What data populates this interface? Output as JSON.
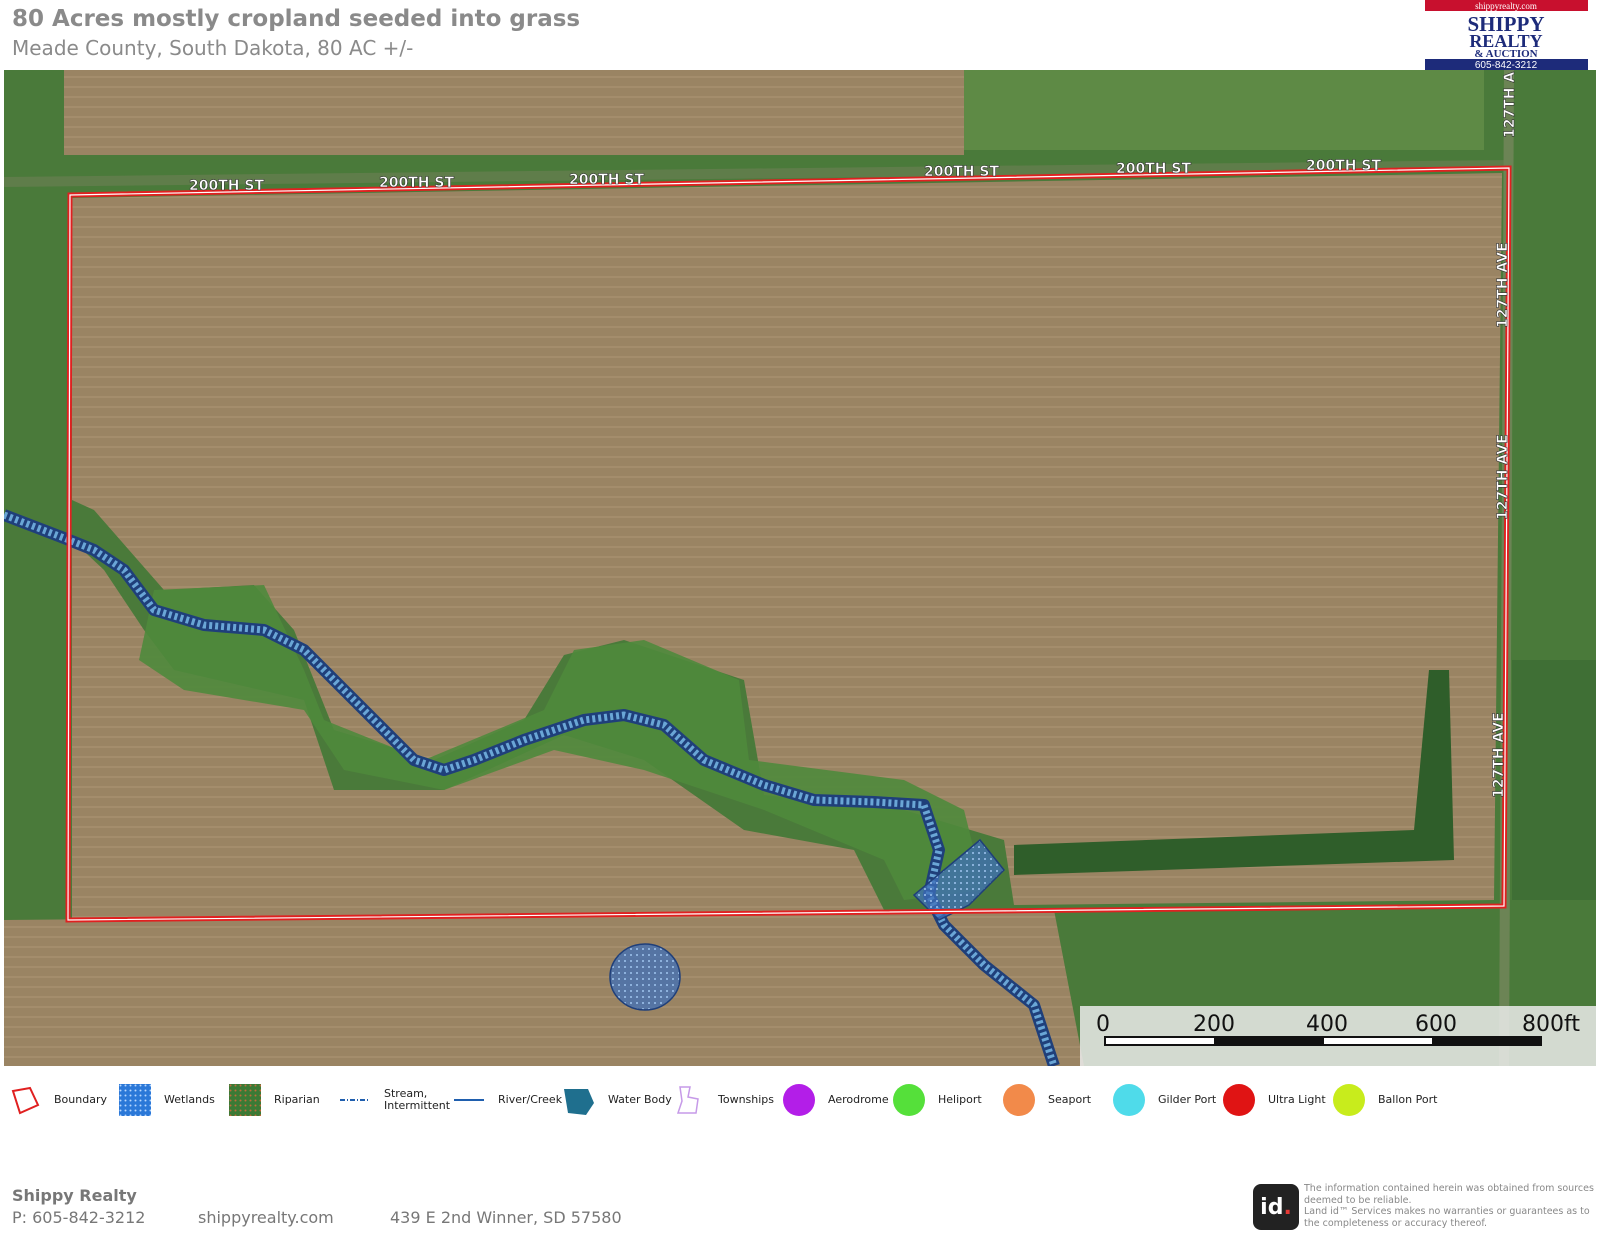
{
  "header": {
    "title": "80 Acres mostly cropland seeded into grass",
    "subtitle": "Meade County, South Dakota, 80 AC +/-"
  },
  "logo": {
    "url_text": "shippyrealty.com",
    "line1": "SHIPPY",
    "line2": "REALTY",
    "line3": "& AUCTION",
    "phone": "605-842-3212"
  },
  "map": {
    "road_labels": {
      "street": "200TH ST",
      "avenue": "127TH AVE",
      "avenue_top_partial": "127TH A"
    },
    "scale_bar": {
      "labels": [
        "0",
        "200",
        "400",
        "600",
        "800ft"
      ]
    },
    "colors": {
      "boundary": "#e02020",
      "water": "#1f5fae",
      "cropland": "#9a8463",
      "grass": "#4f8a3c"
    }
  },
  "legend": [
    {
      "label": "Boundary",
      "icon": "boundary-icon"
    },
    {
      "label": "Wetlands",
      "icon": "wetlands-icon"
    },
    {
      "label": "Riparian",
      "icon": "riparian-icon"
    },
    {
      "label": "Stream,\nIntermittent",
      "icon": "stream-intermittent-icon"
    },
    {
      "label": "River/Creek",
      "icon": "river-creek-icon"
    },
    {
      "label": "Water Body",
      "icon": "water-body-icon"
    },
    {
      "label": "Townships",
      "icon": "townships-icon"
    },
    {
      "label": "Aerodrome",
      "icon": "aerodrome-icon",
      "color": "#b31ee8"
    },
    {
      "label": "Heliport",
      "icon": "heliport-icon",
      "color": "#55e03a"
    },
    {
      "label": "Seaport",
      "icon": "seaport-icon",
      "color": "#f28a4a"
    },
    {
      "label": "Gilder Port",
      "icon": "gilder-port-icon",
      "color": "#4fdbea"
    },
    {
      "label": "Ultra Light",
      "icon": "ultra-light-icon",
      "color": "#e01414"
    },
    {
      "label": "Ballon Port",
      "icon": "ballon-port-icon",
      "color": "#c8ec1c"
    }
  ],
  "footer": {
    "company": "Shippy Realty",
    "phone": "P: 605-842-3212",
    "website": "shippyrealty.com",
    "address": "439 E 2nd Winner, SD 57580",
    "disclaimer_line1": "The information contained herein was obtained from sources deemed to be reliable.",
    "disclaimer_line2": "Land id™ Services makes no warranties or guarantees as to the completeness or accuracy thereof.",
    "id_logo": "id"
  }
}
